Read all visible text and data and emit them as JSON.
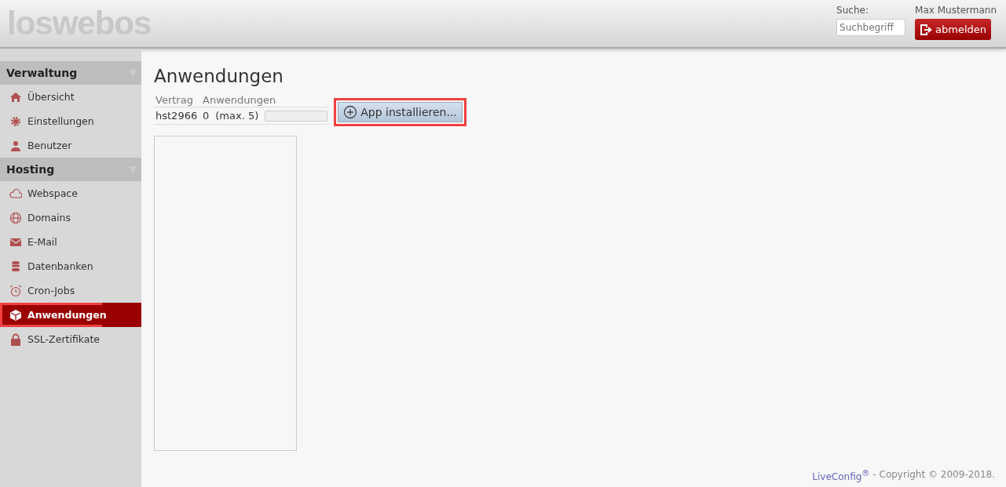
{
  "header": {
    "logo": "loswebos",
    "search_label": "Suche:",
    "search": {
      "placeholder": "Suchbegriff"
    },
    "user": "Max Mustermann",
    "logout": "abmelden"
  },
  "sidebar": [
    {
      "title": "Verwaltung",
      "expanded": true,
      "items": [
        {
          "label": "Übersicht",
          "selected": false
        },
        {
          "label": "Einstellungen",
          "selected": false
        },
        {
          "label": "Benutzer",
          "selected": false
        }
      ]
    },
    {
      "title": "Hosting",
      "expanded": true,
      "items": [
        {
          "label": "Webspace",
          "selected": false
        },
        {
          "label": "Domains",
          "selected": false
        },
        {
          "label": "E-Mail",
          "selected": false
        },
        {
          "label": "Datenbanken",
          "selected": false
        },
        {
          "label": "Cron-Jobs",
          "selected": false
        },
        {
          "label": "Anwendungen",
          "selected": true
        },
        {
          "label": "SSL-Zertifikate",
          "selected": false
        }
      ]
    }
  ],
  "page_title": "Anwendungen",
  "table": {
    "columns": [
      "Vertrag",
      "Anwendungen"
    ],
    "rows": [
      {
        "contract": "hst2966",
        "count": "0",
        "max": "(max. 5)",
        "level": 0
      }
    ]
  },
  "install_button": "App installieren...",
  "footer": {
    "link": "LiveConfig$^{®}$",
    "text": "- Copyright © 2009-2018."
  }
}
